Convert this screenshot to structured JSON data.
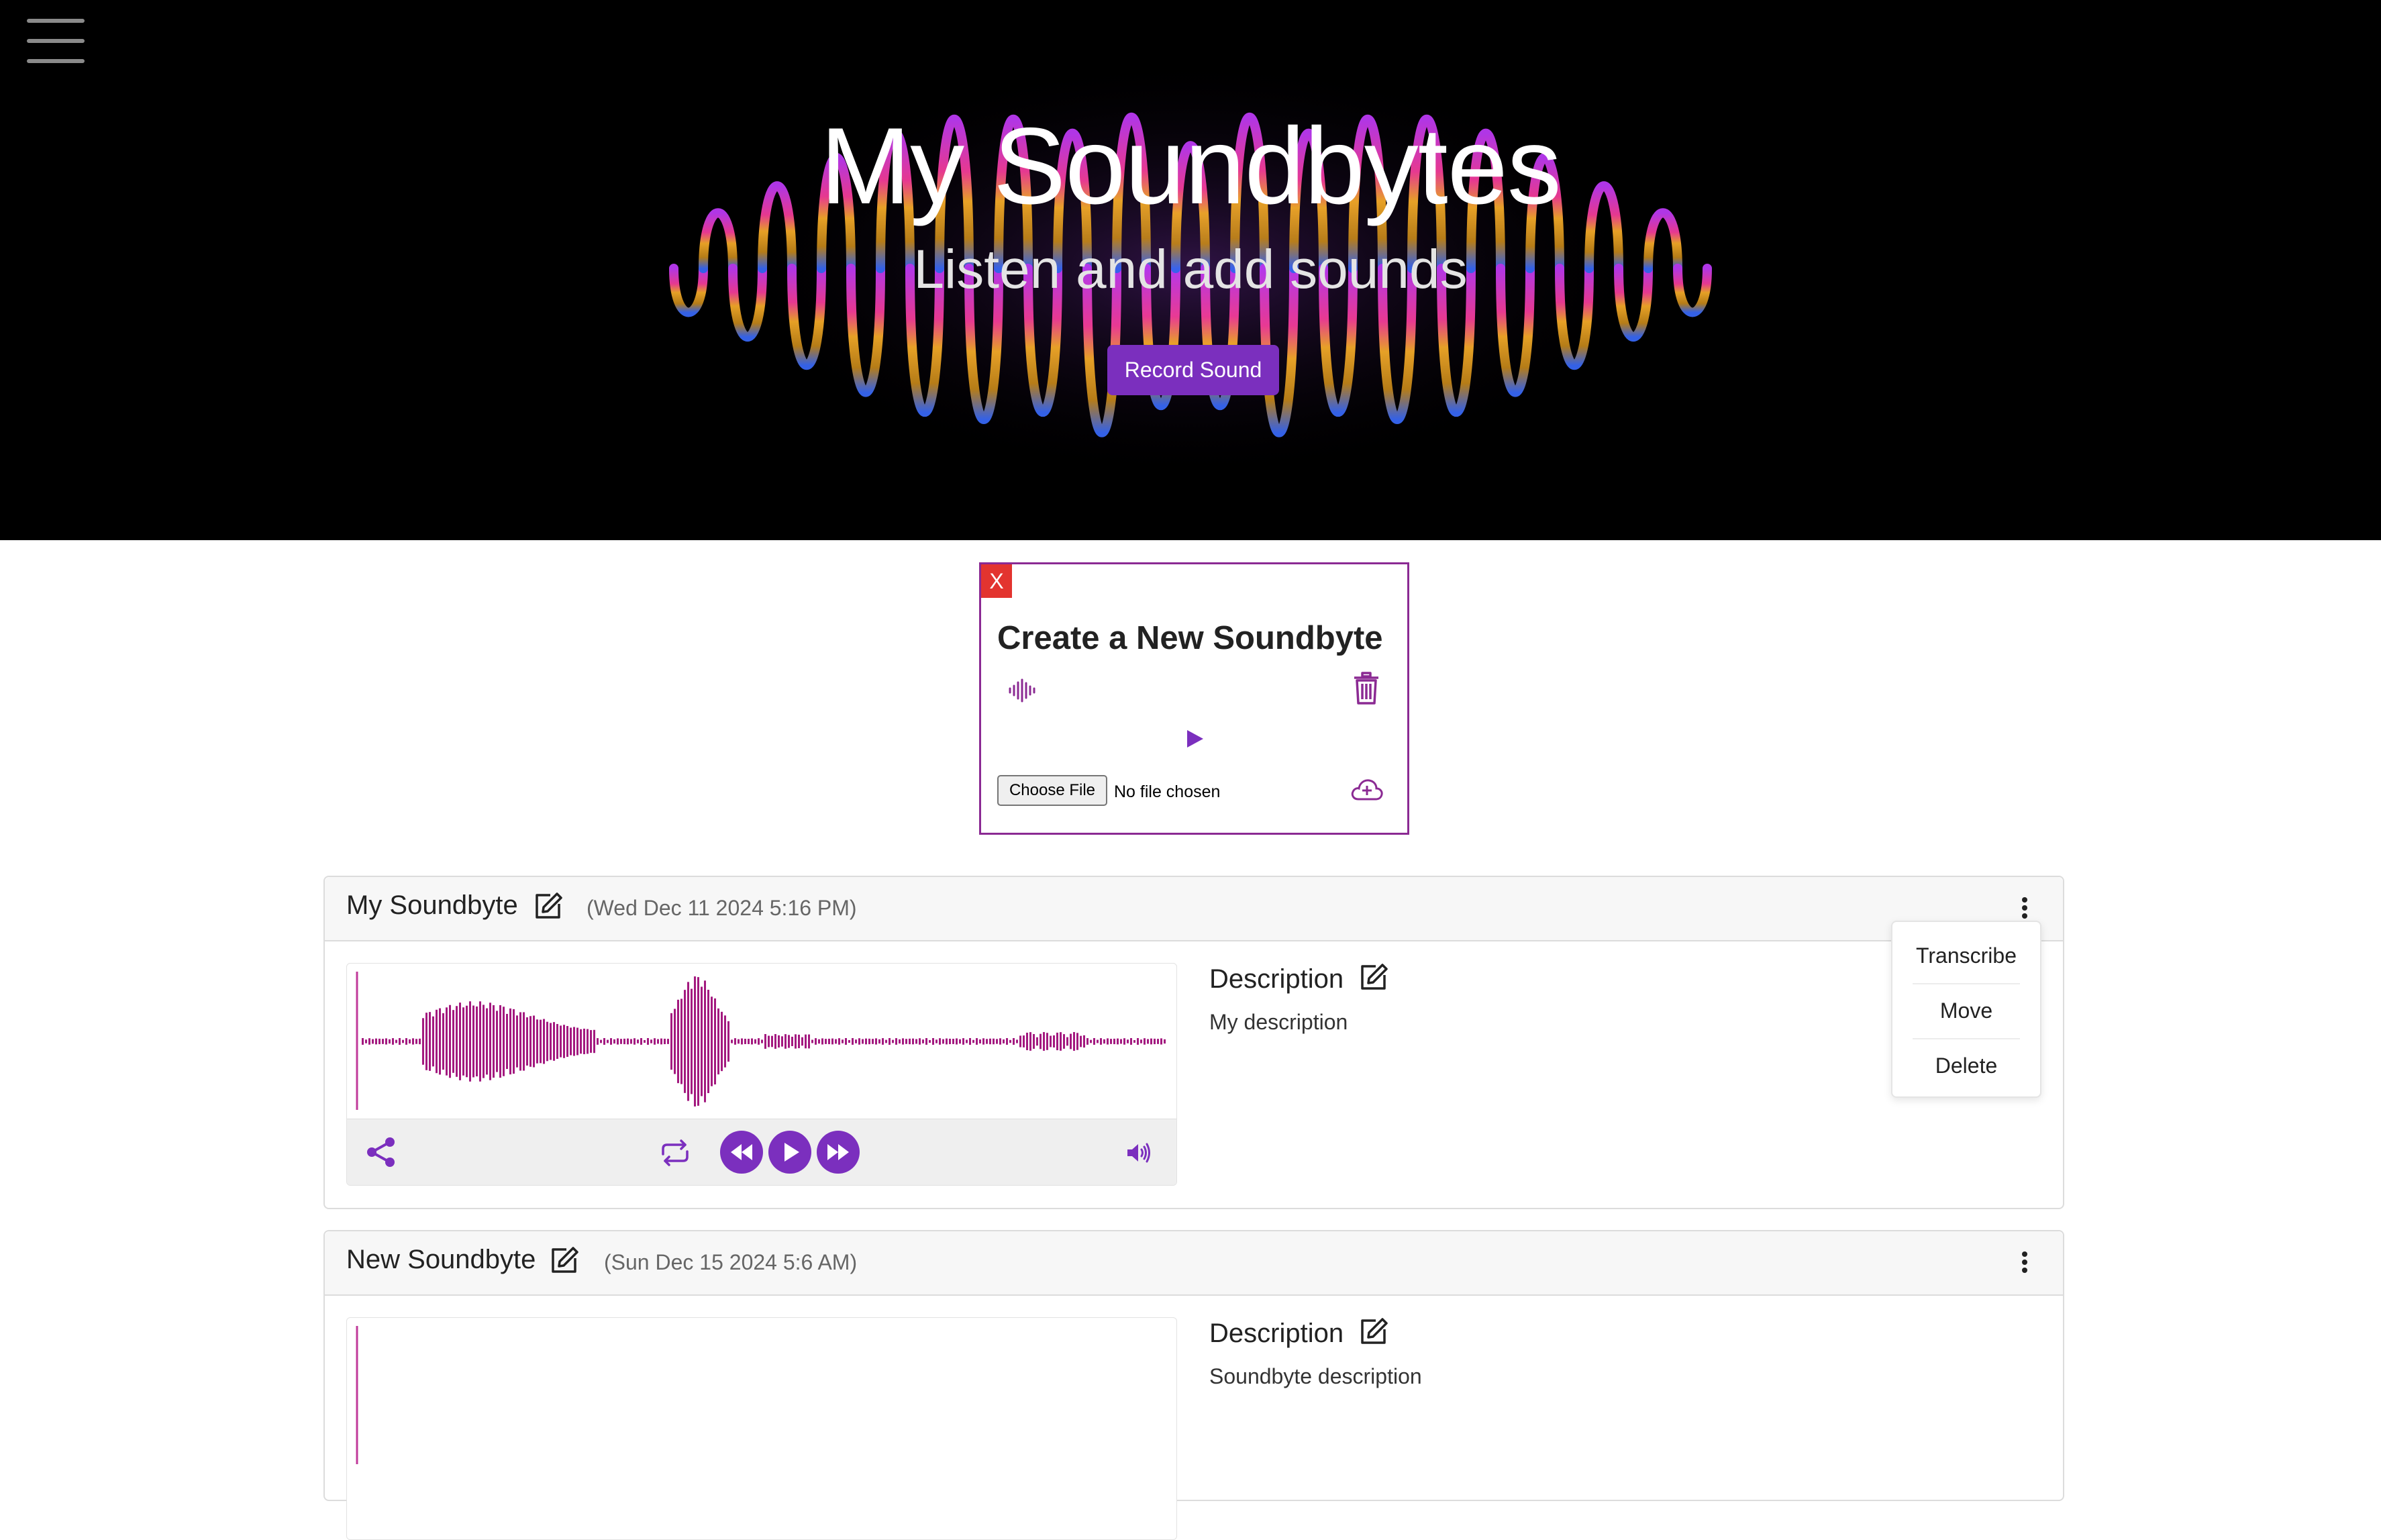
{
  "hero": {
    "title": "My Soundbytes",
    "subtitle": "Listen and add sounds",
    "record_button": "Record Sound"
  },
  "create": {
    "close_label": "X",
    "title": "Create a New Soundbyte",
    "choose_file_label": "Choose File",
    "no_file_text": "No file chosen"
  },
  "soundbytes": [
    {
      "title": "My Soundbyte",
      "date": "(Wed Dec 11 2024 5:16 PM)",
      "description_label": "Description",
      "description": "My description"
    },
    {
      "title": "New Soundbyte",
      "date": "(Sun Dec 15 2024 5:6 AM)",
      "description_label": "Description",
      "description": "Soundbyte description"
    }
  ],
  "menu": {
    "items": [
      "Transcribe",
      "Move",
      "Delete"
    ]
  },
  "colors": {
    "accent": "#7b2fbe",
    "waveform": "#a3197f",
    "close": "#e3342f"
  },
  "icons": [
    "hamburger-menu-icon",
    "sound-wave-icon",
    "trash-icon",
    "play-icon",
    "cloud-upload-icon",
    "edit-icon",
    "more-vertical-icon",
    "share-icon",
    "repeat-icon",
    "rewind-icon",
    "fast-forward-icon",
    "volume-icon"
  ]
}
